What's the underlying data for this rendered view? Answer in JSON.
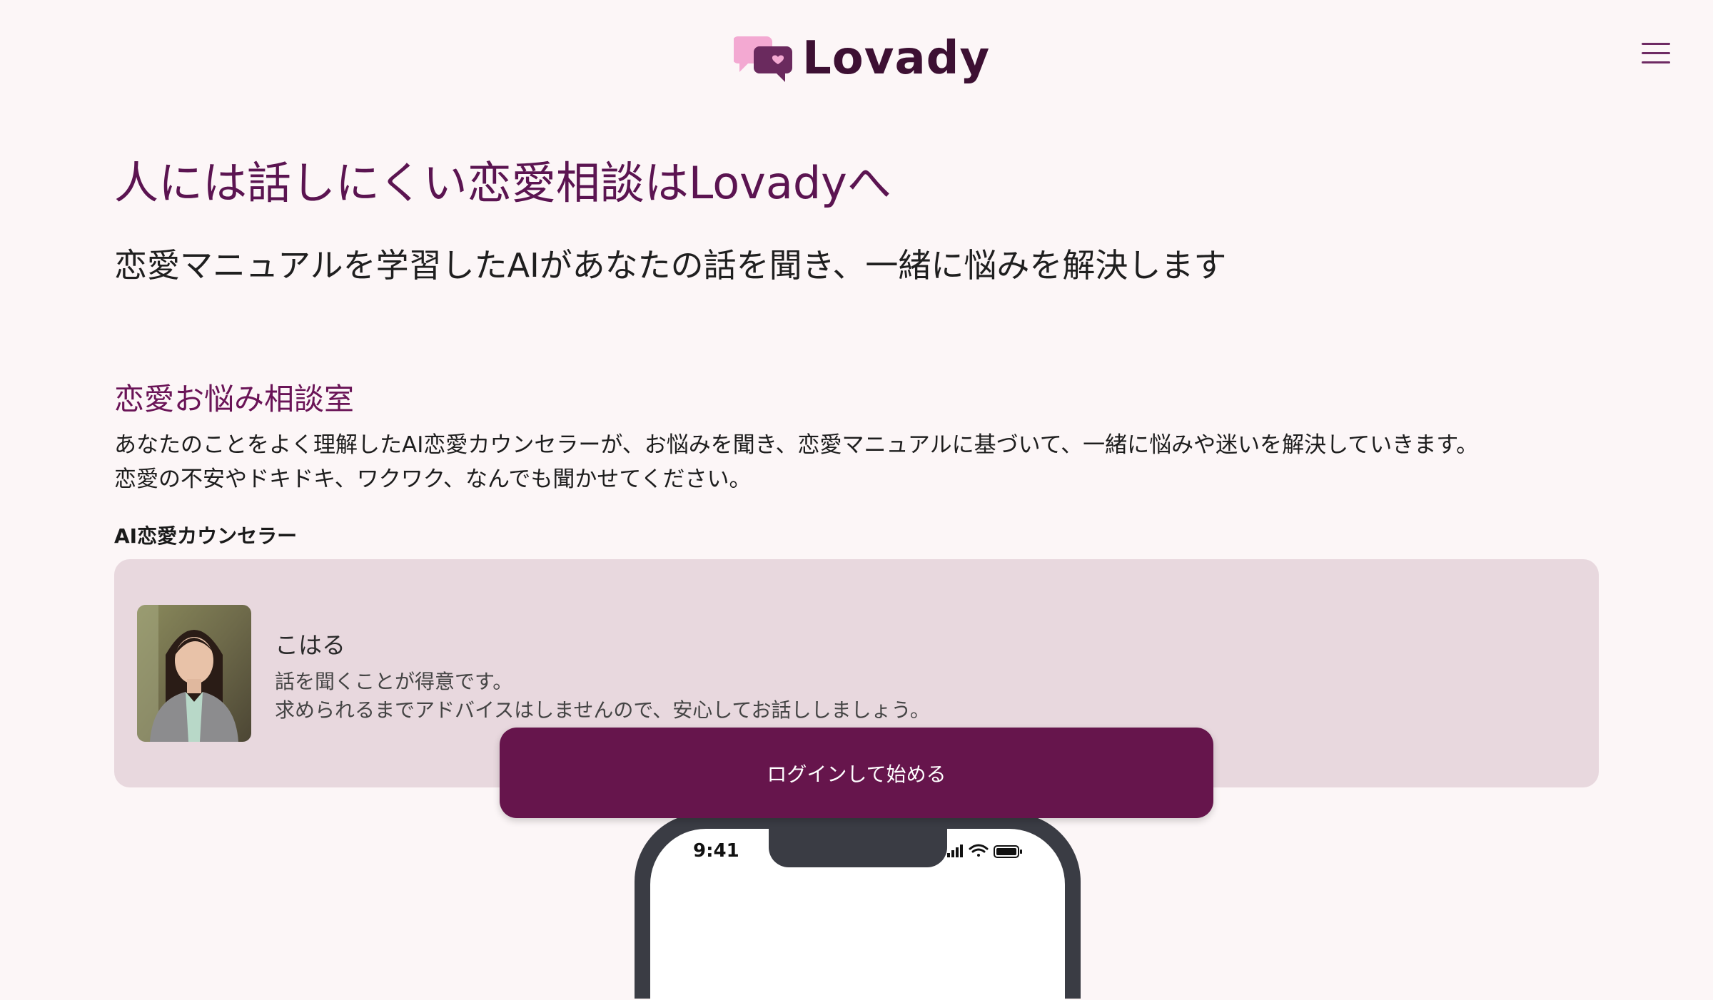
{
  "brand": {
    "name": "Lovady"
  },
  "hero": {
    "title": "人には話しにくい恋愛相談はLovadyへ",
    "subtitle": "恋愛マニュアルを学習したAIがあなたの話を聞き、一緒に悩みを解決します"
  },
  "section": {
    "title": "恋愛お悩み相談室",
    "description": [
      "あなたのことをよく理解したAI恋愛カウンセラーが、お悩みを聞き、恋愛マニュアルに基づいて、一緒に悩みや迷いを解決していきます。",
      "恋愛の不安やドキドキ、ワクワク、なんでも聞かせてください。"
    ],
    "counselor_heading": "AI恋愛カウンセラー"
  },
  "counselor": {
    "name": "こはる",
    "description": [
      "話を聞くことが得意です。",
      "求められるまでアドバイスはしませんので、安心してお話ししましょう。"
    ]
  },
  "cta": {
    "label": "ログインして始める"
  },
  "phone": {
    "time": "9:41"
  },
  "icons": {
    "logo": "chat-bubbles-heart-icon",
    "menu": "hamburger-menu-icon",
    "signal": "signal-icon",
    "wifi": "wifi-icon",
    "battery": "battery-icon"
  },
  "colors": {
    "primary": "#66154c",
    "heading": "#5b1451",
    "card_bg": "#e8d8de",
    "page_bg": "#fcf6f7"
  }
}
